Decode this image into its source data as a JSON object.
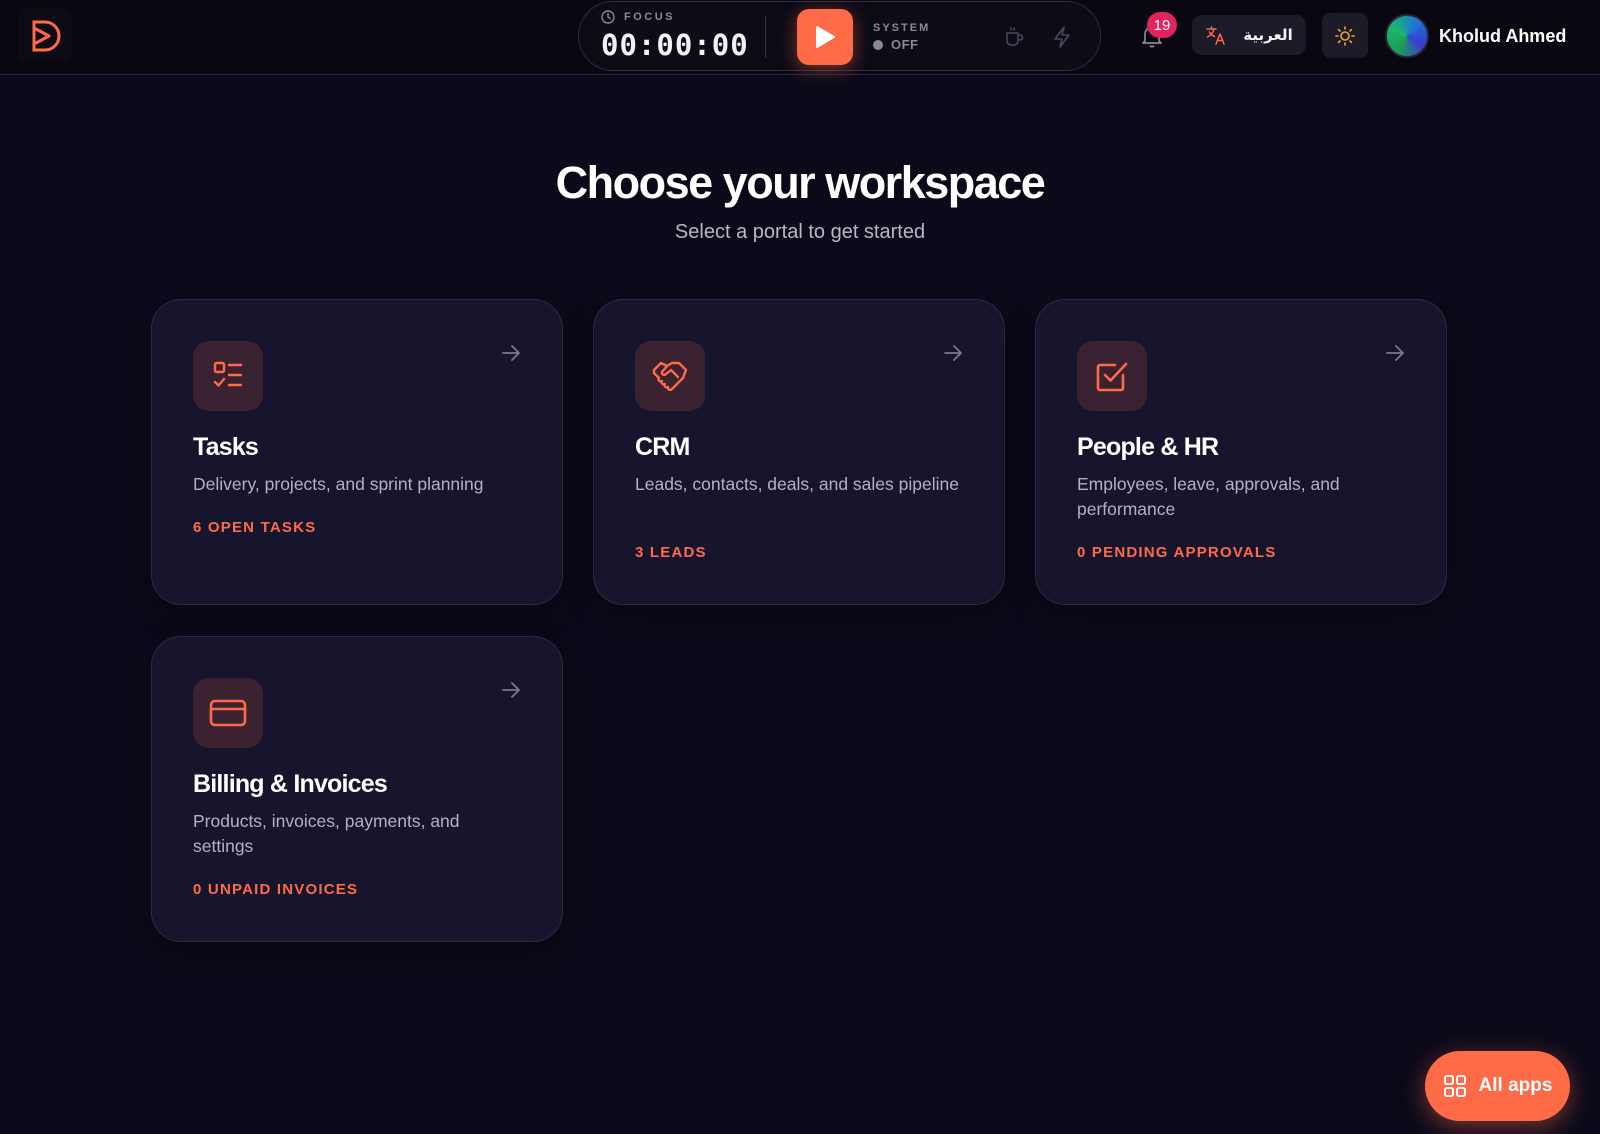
{
  "header": {
    "logo_icon": "brand-d-logo",
    "focus": {
      "label": "FOCUS",
      "time": "00:00:00",
      "play_icon": "play-icon",
      "system_label": "SYSTEM",
      "system_state": "OFF"
    },
    "notifications": {
      "count": "19",
      "icon": "bell-icon"
    },
    "language": {
      "label": "العربية",
      "icon": "translate-icon"
    },
    "theme_icon": "sun-icon",
    "user": {
      "name": "Kholud Ahmed"
    }
  },
  "main": {
    "title": "Choose your workspace",
    "subtitle": "Select a portal to get started",
    "cards": [
      {
        "title": "Tasks",
        "description": "Delivery, projects, and sprint planning",
        "meta": "6 OPEN TASKS",
        "icon": "task-list-icon"
      },
      {
        "title": "CRM",
        "description": "Leads, contacts, deals, and sales pipeline",
        "meta": "3 LEADS",
        "icon": "handshake-icon"
      },
      {
        "title": "People & HR",
        "description": "Employees, leave, approvals, and performance",
        "meta": "0 PENDING APPROVALS",
        "icon": "checkbox-icon"
      },
      {
        "title": "Billing & Invoices",
        "description": "Products, invoices, payments, and settings",
        "meta": "0 UNPAID INVOICES",
        "icon": "credit-card-icon"
      }
    ]
  },
  "fab": {
    "label": "All apps",
    "icon": "grid-icon"
  },
  "colors": {
    "accent": "#ff6a47",
    "background": "#0b0a1a",
    "card_background": "#17152e",
    "badge": "#e0245e"
  }
}
